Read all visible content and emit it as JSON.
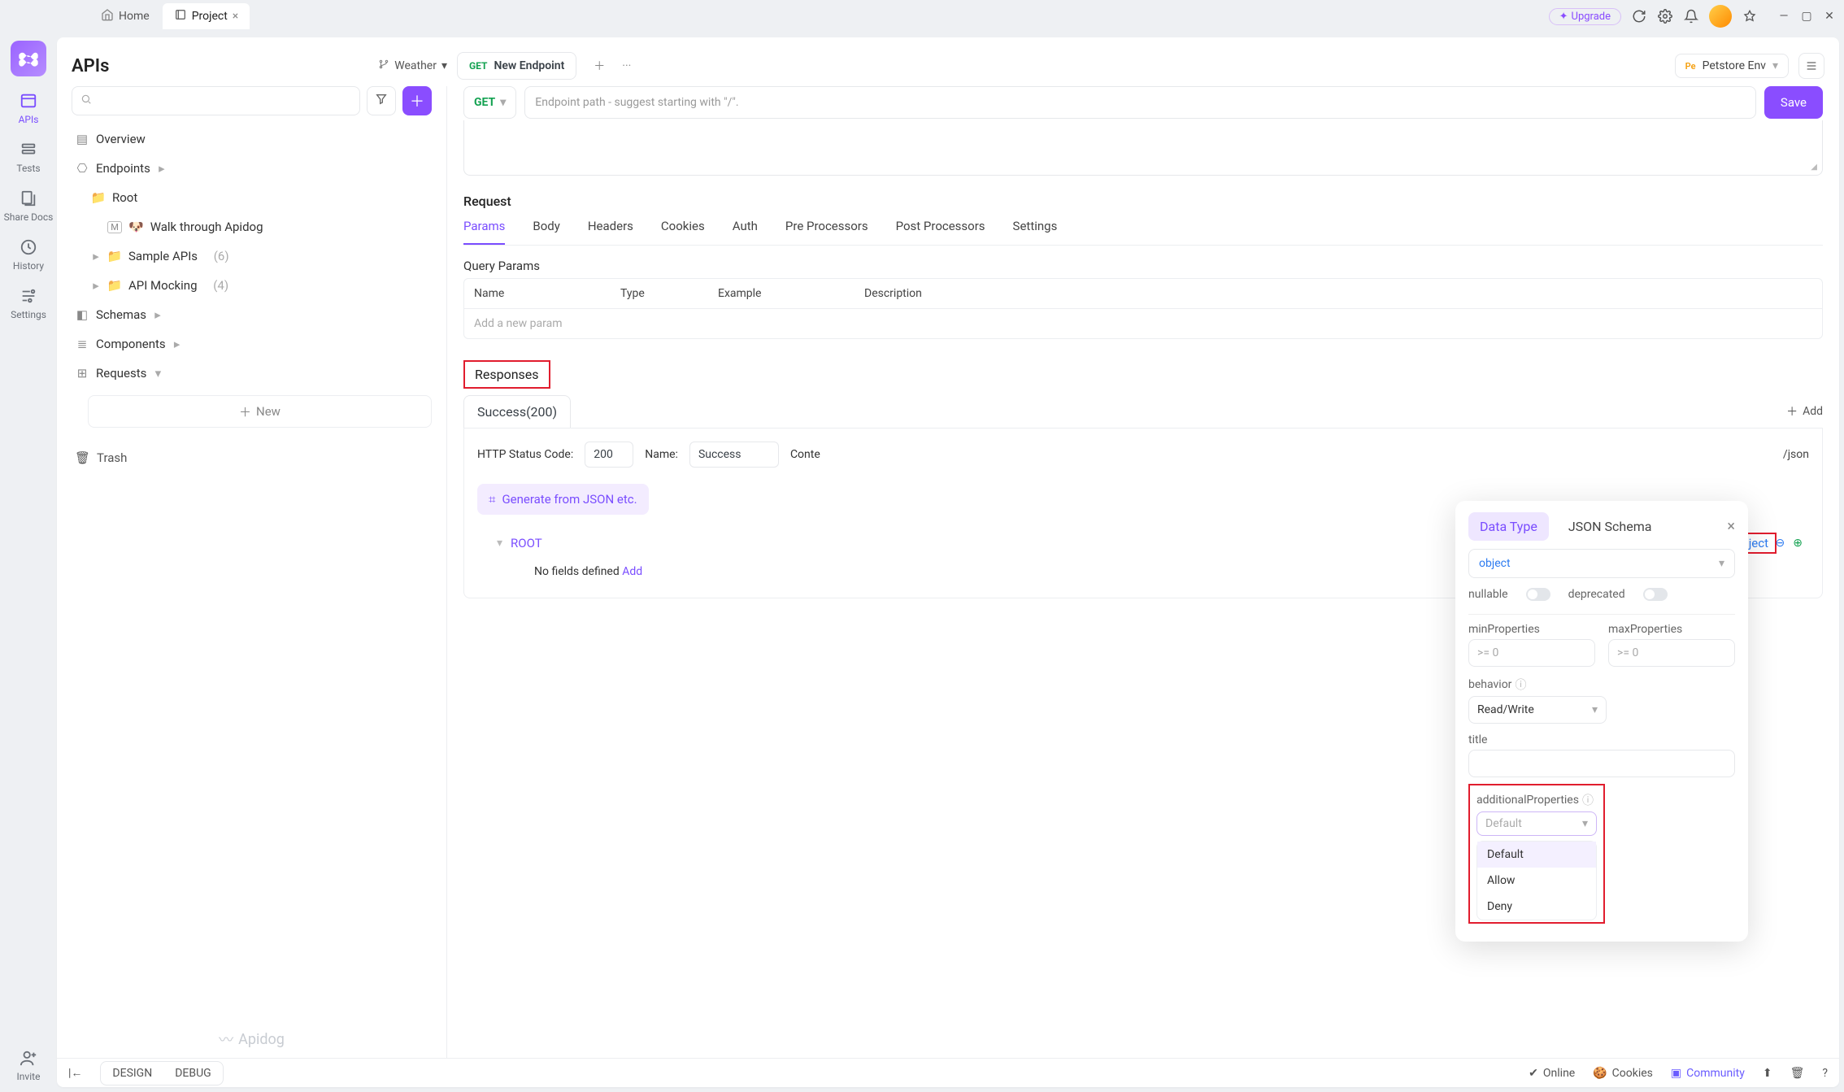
{
  "titlebar": {
    "tabs": [
      {
        "label": "Home",
        "active": false
      },
      {
        "label": "Project",
        "active": true
      }
    ],
    "upgrade": "Upgrade"
  },
  "rail": {
    "items": [
      {
        "key": "apis",
        "label": "APIs"
      },
      {
        "key": "tests",
        "label": "Tests"
      },
      {
        "key": "sharedocs",
        "label": "Share Docs"
      },
      {
        "key": "history",
        "label": "History"
      },
      {
        "key": "settings",
        "label": "Settings"
      }
    ],
    "invite": "Invite"
  },
  "header": {
    "title": "APIs",
    "branch": "Weather",
    "endpoint_tab_method": "GET",
    "endpoint_tab_name": "New Endpoint",
    "env_prefix": "Pe",
    "env_name": "Petstore Env"
  },
  "sidebar": {
    "overview": "Overview",
    "endpoints": "Endpoints",
    "root": "Root",
    "walk": "Walk through Apidog",
    "sample": "Sample APIs",
    "sample_count": "(6)",
    "mock": "API Mocking",
    "mock_count": "(4)",
    "schemas": "Schemas",
    "components": "Components",
    "requests": "Requests",
    "new": "New",
    "trash": "Trash",
    "footer_brand": "Apidog"
  },
  "editor": {
    "method": "GET",
    "url_placeholder": "Endpoint path - suggest starting with \"/\".",
    "save": "Save",
    "request_label": "Request",
    "tabs": [
      "Params",
      "Body",
      "Headers",
      "Cookies",
      "Auth",
      "Pre Processors",
      "Post Processors",
      "Settings"
    ],
    "active_tab": "Params",
    "query_params_label": "Query Params",
    "columns": {
      "name": "Name",
      "type": "Type",
      "example": "Example",
      "description": "Description"
    },
    "add_param": "Add a new param",
    "responses_label": "Responses",
    "response_tab": "Success(200)",
    "add_response": "Add",
    "http_code_label": "HTTP Status Code:",
    "http_code": "200",
    "name_label": "Name:",
    "name_value": "Success",
    "content_label": "Conte",
    "content_value": "/json",
    "generate": "Generate from JSON etc.",
    "root": "ROOT",
    "root_type": "object",
    "no_fields": "No fields defined",
    "add_field": "Add"
  },
  "popover": {
    "tabs": [
      "Data Type",
      "JSON Schema"
    ],
    "active": "Data Type",
    "type_value": "object",
    "flags": {
      "nullable": "nullable",
      "deprecated": "deprecated"
    },
    "min_lbl": "minProperties",
    "max_lbl": "maxProperties",
    "ge0": ">= 0",
    "behavior_lbl": "behavior",
    "behavior_value": "Read/Write",
    "title_lbl": "title",
    "additional_lbl": "additionalProperties",
    "additional_value": "Default",
    "options": [
      "Default",
      "Allow",
      "Deny"
    ]
  },
  "status": {
    "design": "DESIGN",
    "debug": "DEBUG",
    "online": "Online",
    "cookies": "Cookies",
    "community": "Community"
  }
}
